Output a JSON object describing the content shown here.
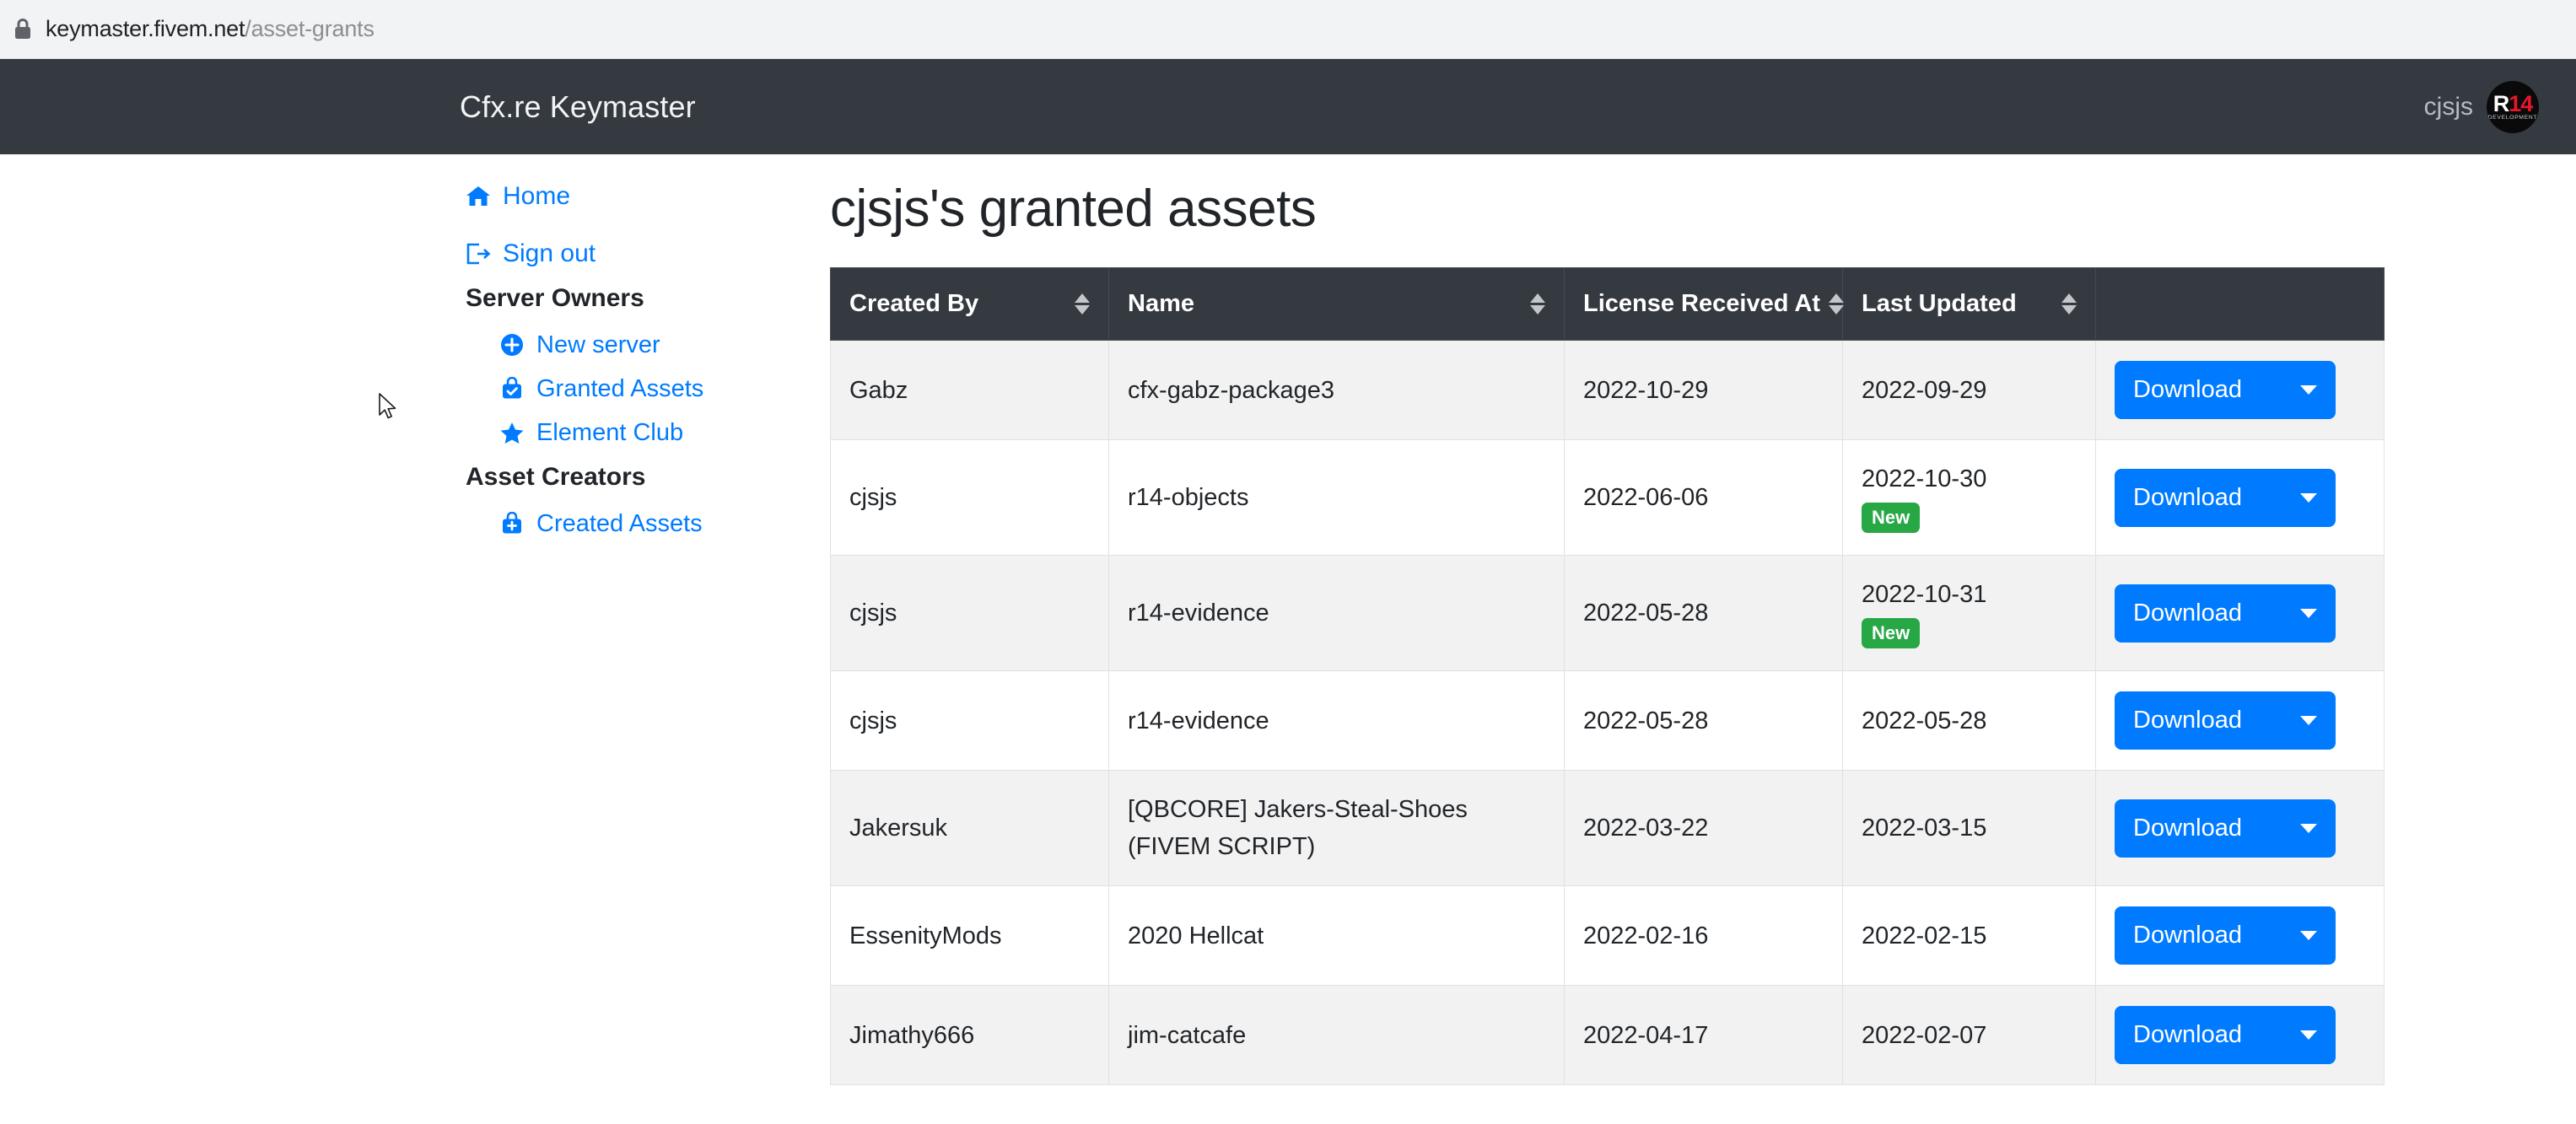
{
  "browser": {
    "lock_icon": "lock-icon",
    "url_domain": "keymaster.fivem.net",
    "url_path": "/asset-grants"
  },
  "navbar": {
    "brand": "Cfx.re Keymaster",
    "username": "cjsjs",
    "avatar": {
      "logo_main_left": "R",
      "logo_main_right": "14",
      "logo_sub": "DEVELOPMENT"
    },
    "background_color": "#343a40"
  },
  "sidebar": {
    "links": [
      {
        "label": "Home",
        "icon": "home-icon"
      },
      {
        "label": "Sign out",
        "icon": "sign-out-icon"
      }
    ],
    "sections": [
      {
        "heading": "Server Owners",
        "items": [
          {
            "label": "New server",
            "icon": "plus-circle-icon"
          },
          {
            "label": "Granted Assets",
            "icon": "briefcase-check-icon"
          },
          {
            "label": "Element Club",
            "icon": "star-icon"
          }
        ]
      },
      {
        "heading": "Asset Creators",
        "items": [
          {
            "label": "Created Assets",
            "icon": "briefcase-plus-icon"
          }
        ]
      }
    ],
    "link_color": "#007bff"
  },
  "main": {
    "page_title": "cjsjs's granted assets",
    "table": {
      "columns": [
        {
          "label": "Created By",
          "sortable": true
        },
        {
          "label": "Name",
          "sortable": true
        },
        {
          "label": "License Received At",
          "sortable": true
        },
        {
          "label": "Last Updated",
          "sortable": true
        },
        {
          "label": "",
          "sortable": false
        }
      ],
      "rows": [
        {
          "created_by": "Gabz",
          "name": "cfx-gabz-package3",
          "license_received_at": "2022-10-29",
          "last_updated": "2022-09-29",
          "badge": "",
          "action_label": "Download"
        },
        {
          "created_by": "cjsjs",
          "name": "r14-objects",
          "license_received_at": "2022-06-06",
          "last_updated": "2022-10-30",
          "badge": "New",
          "action_label": "Download"
        },
        {
          "created_by": "cjsjs",
          "name": "r14-evidence",
          "license_received_at": "2022-05-28",
          "last_updated": "2022-10-31",
          "badge": "New",
          "action_label": "Download"
        },
        {
          "created_by": "cjsjs",
          "name": "r14-evidence",
          "license_received_at": "2022-05-28",
          "last_updated": "2022-05-28",
          "badge": "",
          "action_label": "Download"
        },
        {
          "created_by": "Jakersuk",
          "name": "[QBCORE] Jakers-Steal-Shoes (FIVEM SCRIPT)",
          "license_received_at": "2022-03-22",
          "last_updated": "2022-03-15",
          "badge": "",
          "action_label": "Download"
        },
        {
          "created_by": "EssenityMods",
          "name": "2020 Hellcat",
          "license_received_at": "2022-02-16",
          "last_updated": "2022-02-15",
          "badge": "",
          "action_label": "Download"
        },
        {
          "created_by": "Jimathy666",
          "name": "jim-catcafe",
          "license_received_at": "2022-04-17",
          "last_updated": "2022-02-07",
          "badge": "",
          "action_label": "Download"
        }
      ],
      "header_background": "#343a40",
      "badge_color": "#28a745",
      "button_color": "#007bff"
    }
  },
  "cursor": {
    "icon": "mouse-pointer-icon"
  }
}
